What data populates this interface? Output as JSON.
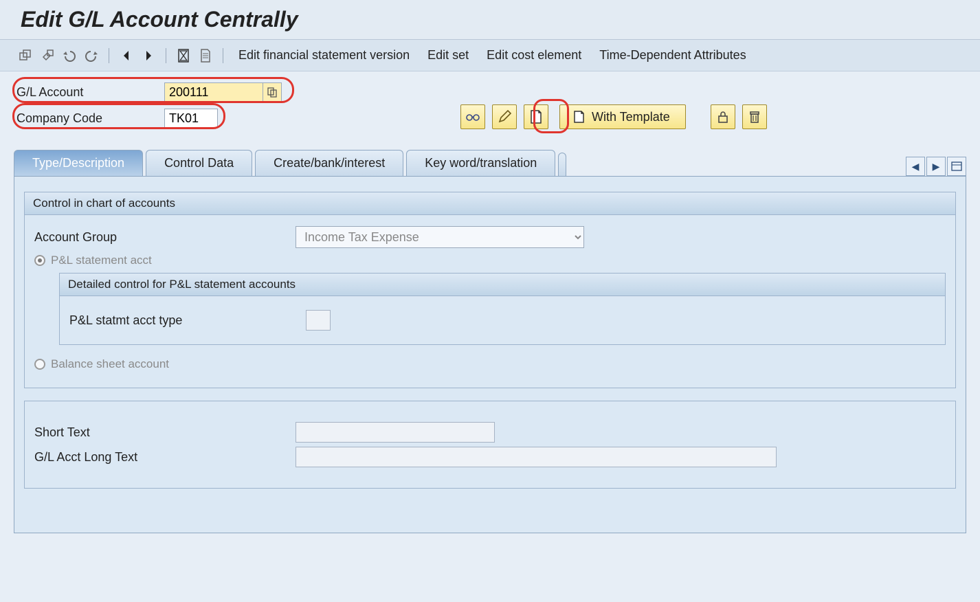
{
  "title": "Edit G/L Account Centrally",
  "toolbar": {
    "text_items": [
      "Edit financial statement version",
      "Edit set",
      "Edit cost element",
      "Time-Dependent Attributes"
    ]
  },
  "header": {
    "gl_account_label": "G/L Account",
    "gl_account_value": "200111",
    "company_code_label": "Company Code",
    "company_code_value": "TK01",
    "with_template_label": "With Template"
  },
  "tabs": {
    "type_desc": "Type/Description",
    "control_data": "Control Data",
    "create_bank": "Create/bank/interest",
    "key_word": "Key word/translation"
  },
  "panel1": {
    "title": "Control in chart of accounts",
    "account_group_label": "Account Group",
    "account_group_value": "Income Tax Expense",
    "pl_radio_label": "P&L statement acct",
    "inner_title": "Detailed control for P&L statement accounts",
    "pl_type_label": "P&L statmt acct type",
    "bs_radio_label": "Balance sheet account"
  },
  "panel2": {
    "short_text_label": "Short Text",
    "long_text_label": "G/L Acct Long Text"
  }
}
